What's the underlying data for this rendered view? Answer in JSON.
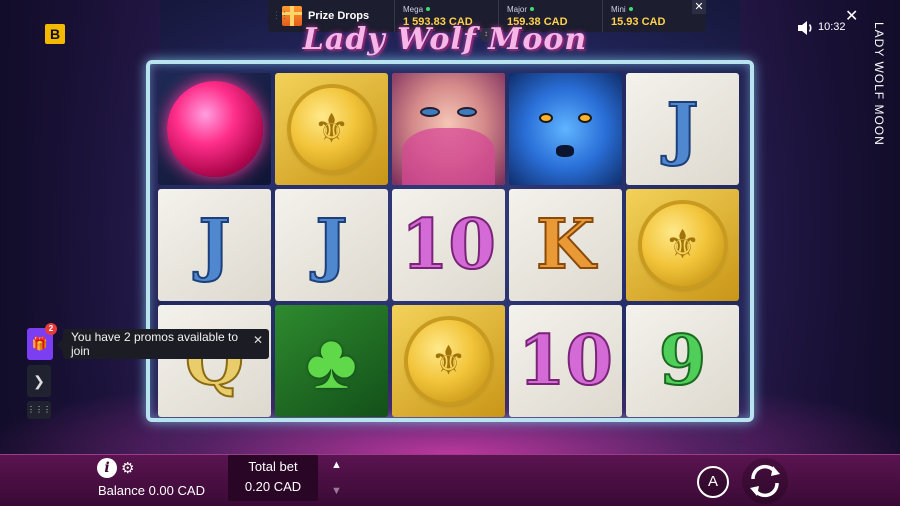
{
  "brand": {
    "logo_letter": "B"
  },
  "prize_drops": {
    "title": "Prize Drops",
    "tiers": [
      {
        "label": "Mega",
        "value": "1 593.83 CAD"
      },
      {
        "label": "Major",
        "value": "159.38 CAD"
      },
      {
        "label": "Mini",
        "value": "15.93 CAD"
      }
    ],
    "close_glyph": "✕",
    "handle_glyph": "↕"
  },
  "status": {
    "time": "10:32",
    "close_glyph": "✕",
    "side_title": "LADY WOLF MOON"
  },
  "game": {
    "title": "Lady Wolf Moon"
  },
  "reels": {
    "row1": [
      "orb",
      "coin",
      "lady",
      "wolf",
      "J"
    ],
    "row2": [
      "J",
      "J",
      "10",
      "K",
      "coin"
    ],
    "row3": [
      "Q",
      "clover",
      "coin",
      "10",
      "9"
    ]
  },
  "promo": {
    "badge_count": "2",
    "message": "You have 2 promos available to join",
    "close_glyph": "✕"
  },
  "bottom": {
    "balance": "Balance 0.00 CAD",
    "total_bet_label": "Total bet",
    "total_bet_value": "0.20 CAD",
    "auto_label": "A",
    "info_glyph": "i"
  },
  "colors": {
    "accent_pink": "#e24bc6",
    "prize_gold": "#ffd24a",
    "promo_purple": "#7b3ef2"
  }
}
